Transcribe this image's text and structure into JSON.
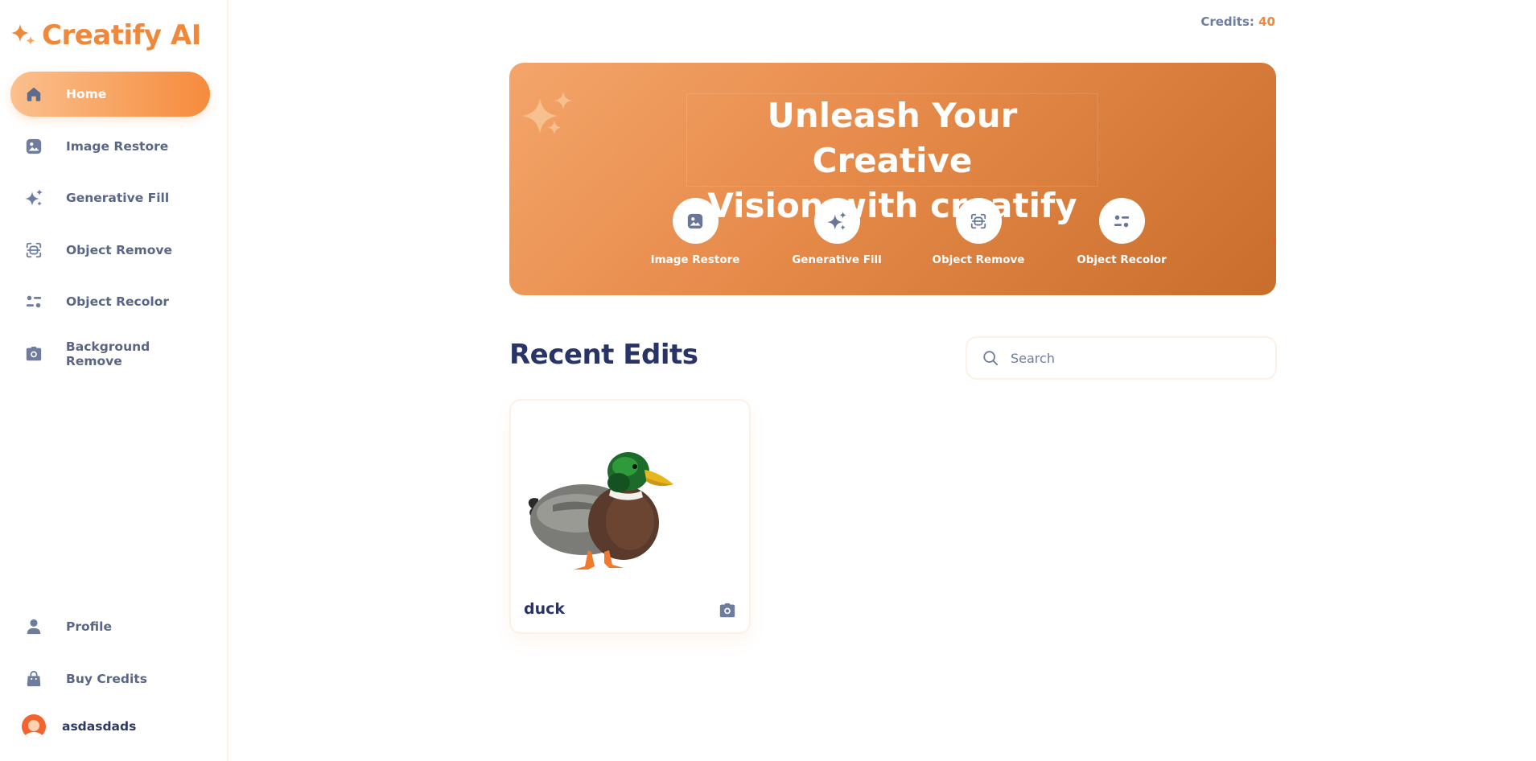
{
  "app": {
    "name": "Creatify AI",
    "brand_color": "#f0883b",
    "logo_icon": "sparkle-icon"
  },
  "sidebar": {
    "items": [
      {
        "label": "Home",
        "icon": "home-icon",
        "active": true
      },
      {
        "label": "Image Restore",
        "icon": "image-icon",
        "active": false
      },
      {
        "label": "Generative Fill",
        "icon": "sparkles-icon",
        "active": false
      },
      {
        "label": "Object Remove",
        "icon": "scan-icon",
        "active": false
      },
      {
        "label": "Object Recolor",
        "icon": "filter-icon",
        "active": false
      },
      {
        "label": "Background Remove",
        "icon": "camera-icon",
        "active": false
      }
    ],
    "bottom_items": [
      {
        "label": "Profile",
        "icon": "user-icon"
      },
      {
        "label": "Buy Credits",
        "icon": "bag-icon"
      }
    ],
    "user": {
      "name": "asdasdads",
      "avatar_color": "#f3632d"
    }
  },
  "header": {
    "credits_label": "Credits:",
    "credits_value": "40"
  },
  "hero": {
    "title_line1": "Unleash Your Creative",
    "title_line2": "Vision with creatify",
    "tools": [
      {
        "label": "Image Restore",
        "icon": "image-icon"
      },
      {
        "label": "Generative Fill",
        "icon": "sparkles-icon"
      },
      {
        "label": "Object Remove",
        "icon": "scan-icon"
      },
      {
        "label": "Object Recolor",
        "icon": "filter-icon"
      }
    ]
  },
  "recent": {
    "title": "Recent Edits",
    "search_placeholder": "Search",
    "items": [
      {
        "title": "duck",
        "type_icon": "camera-icon",
        "image": "duck-image"
      }
    ]
  }
}
